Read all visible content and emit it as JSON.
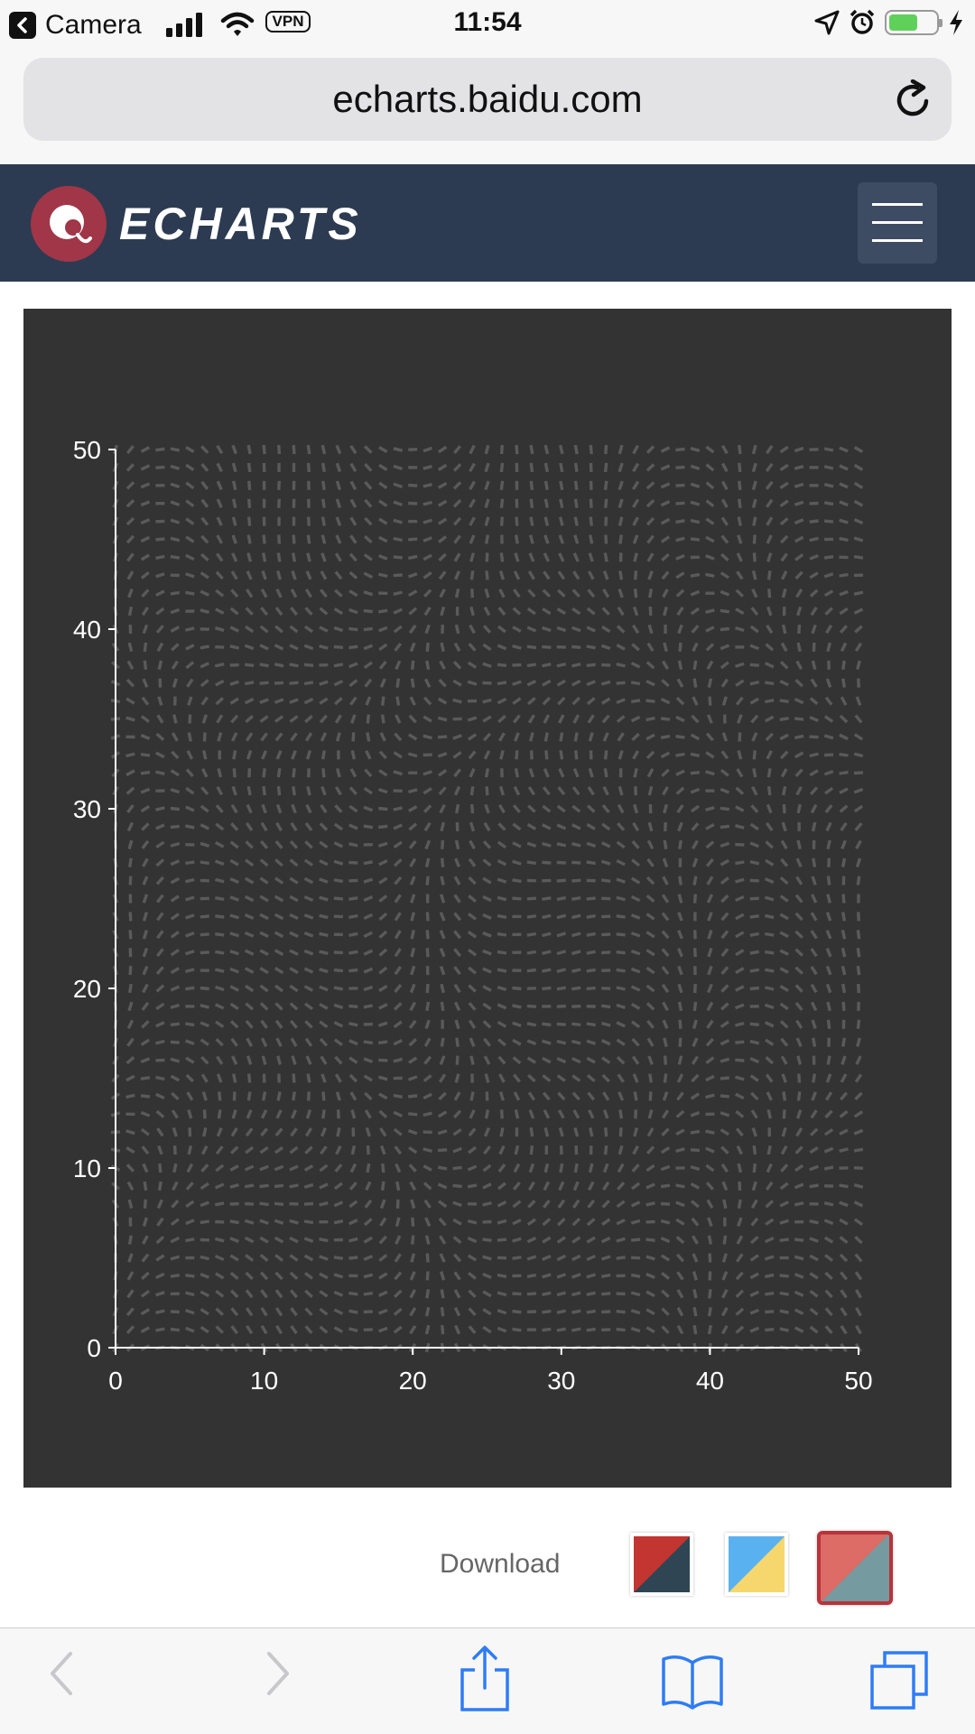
{
  "status_bar": {
    "back_app": "Camera",
    "vpn": "VPN",
    "time": "11:54",
    "battery_level": 0.62
  },
  "browser": {
    "url": "echarts.baidu.com"
  },
  "site": {
    "logo_text": "ECHARTS",
    "accent_color": "#a03648",
    "nav_color": "#2c3b51"
  },
  "chart_data": {
    "type": "scatter",
    "description_type": "vector-field",
    "background": "#333333",
    "mark_color": "#5a5a5a",
    "x": {
      "min": 0,
      "max": 50,
      "ticks": [
        "0",
        "10",
        "20",
        "30",
        "40",
        "50"
      ]
    },
    "y": {
      "min": 0,
      "max": 50,
      "ticks": [
        "0",
        "10",
        "20",
        "30",
        "40",
        "50"
      ]
    },
    "grid": false,
    "field_resolution": 1
  },
  "download": {
    "label": "Download",
    "themes": [
      {
        "name": "default",
        "colors": [
          "#c23531",
          "#2f4554"
        ]
      },
      {
        "name": "light",
        "colors": [
          "#5ab1ef",
          "#f5d76e"
        ]
      },
      {
        "name": "dark",
        "colors": [
          "#dd6b66",
          "#759aa0"
        ],
        "selected": true
      }
    ]
  }
}
